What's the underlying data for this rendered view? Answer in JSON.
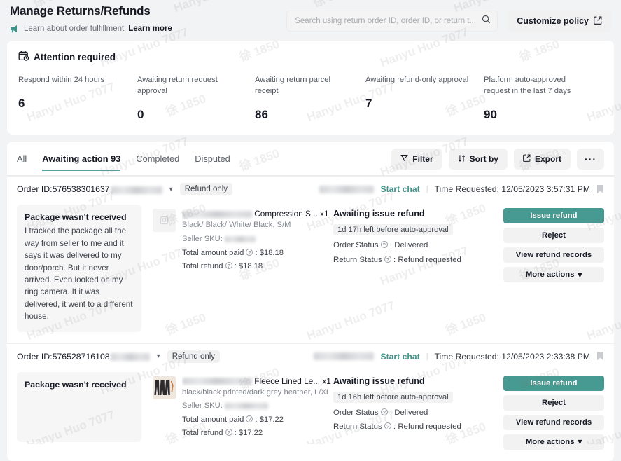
{
  "header": {
    "title": "Manage Returns/Refunds",
    "banner_icon": "megaphone-icon",
    "banner_text": "Learn about order fulfillment",
    "banner_link": "Learn more",
    "search_placeholder": "Search using return order ID, order ID, or return t...",
    "search_value": "",
    "search_icon": "search-icon",
    "customize_label": "Customize policy",
    "customize_icon": "external-link-icon"
  },
  "attention": {
    "icon": "calendar-clock-icon",
    "title": "Attention required",
    "stats": [
      {
        "label": "Respond within 24 hours",
        "value": "6"
      },
      {
        "label": "Awaiting return request approval",
        "value": "0"
      },
      {
        "label": "Awaiting return parcel receipt",
        "value": "86"
      },
      {
        "label": "Awaiting refund-only approval",
        "value": "7"
      },
      {
        "label": "Platform auto-approved request in the last 7 days",
        "value": "90"
      }
    ]
  },
  "list": {
    "tabs": [
      {
        "label": "All",
        "active": false
      },
      {
        "label": "Awaiting action 93",
        "active": true
      },
      {
        "label": "Completed",
        "active": false
      },
      {
        "label": "Disputed",
        "active": false
      }
    ],
    "tools": [
      {
        "label": "Filter",
        "icon": "filter-icon"
      },
      {
        "label": "Sort by",
        "icon": "sort-icon"
      },
      {
        "label": "Export",
        "icon": "export-icon"
      },
      {
        "label": "···",
        "icon": "more-icon"
      }
    ],
    "accent_color": "#479a91",
    "orders": [
      {
        "order_id_label": "Order ID:",
        "order_id": "576538301637",
        "order_id_redacted": true,
        "expand_icon": "chevron-down-icon",
        "type_pill": "Refund only",
        "buyer_redacted": true,
        "chat_label": "Start chat",
        "time_label": "Time Requested: 12/05/2023 3:57:31 PM",
        "flag_icon": "flag-icon",
        "reason_title": "Package wasn't received",
        "reason_body": "I tracked the package all the way from seller to me and it says it was delivered to my door/porch. But it never arrived. Even looked on my ring camera. If it was delivered, it went to a different house.",
        "thumb_icon": "image-placeholder-icon",
        "product_name": "Compression S...",
        "product_qty": "x1",
        "product_variant": "Black/ Black/ White/ Black, S/M",
        "sku_label": "Seller SKU:",
        "sku_redacted": true,
        "paid_label": "Total amount paid",
        "paid_value": "$18.18",
        "refund_label": "Total refund",
        "refund_value": "$18.18",
        "status_title": "Awaiting issue refund",
        "countdown": "1d 17h left before auto-approval",
        "order_status_label": "Order Status",
        "order_status_value": "Delivered",
        "return_status_label": "Return Status",
        "return_status_value": "Refund requested",
        "actions": [
          {
            "label": "Issue refund",
            "primary": true
          },
          {
            "label": "Reject",
            "primary": false
          },
          {
            "label": "View refund records",
            "primary": false
          },
          {
            "label": "More actions",
            "primary": false,
            "icon": "chevron-down-icon"
          }
        ]
      },
      {
        "order_id_label": "Order ID:",
        "order_id": "576528716108",
        "order_id_redacted": true,
        "expand_icon": "chevron-down-icon",
        "type_pill": "Refund only",
        "buyer_redacted": true,
        "chat_label": "Start chat",
        "time_label": "Time Requested: 12/05/2023 2:33:38 PM",
        "flag_icon": "flag-icon",
        "reason_title": "Package wasn't received",
        "reason_body": "",
        "thumb_icon": "product-photo",
        "product_name": "Fleece Lined Le...",
        "product_qty": "x1",
        "product_variant": "black/black printed/dark grey heather, L/XL",
        "sku_label": "Seller SKU:",
        "sku_redacted": true,
        "paid_label": "Total amount paid",
        "paid_value": "$17.22",
        "refund_label": "Total refund",
        "refund_value": "$17.22",
        "status_title": "Awaiting issue refund",
        "countdown": "1d 16h left before auto-approval",
        "order_status_label": "Order Status",
        "order_status_value": "Delivered",
        "return_status_label": "Return Status",
        "return_status_value": "Refund requested",
        "actions": [
          {
            "label": "Issue refund",
            "primary": true
          },
          {
            "label": "Reject",
            "primary": false
          },
          {
            "label": "View refund records",
            "primary": false
          },
          {
            "label": "More actions",
            "primary": false,
            "icon": "chevron-down-icon"
          }
        ]
      }
    ]
  },
  "watermark": {
    "text_a": "Hanyu Huo 7077",
    "text_b": "徐 1850"
  }
}
